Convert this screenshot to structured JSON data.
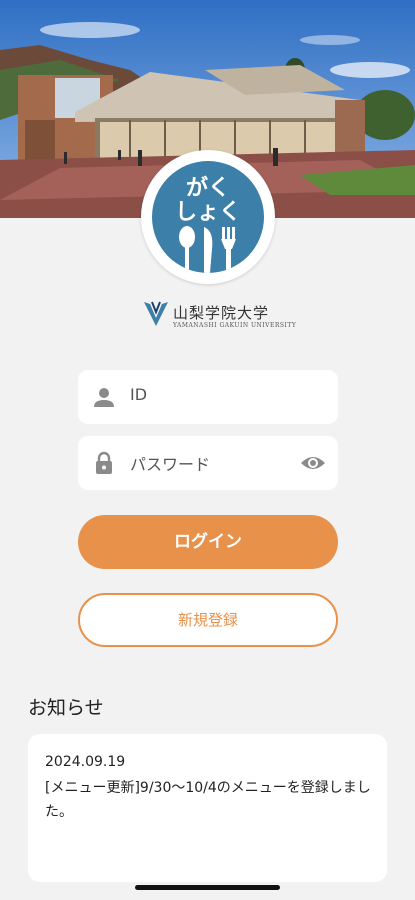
{
  "app": {
    "logo_line1": "がく",
    "logo_line2": "しょく",
    "university_name": "山梨学院大学",
    "university_sub": "YAMANASHI GAKUIN UNIVERSITY"
  },
  "form": {
    "id_placeholder": "ID",
    "password_placeholder": "パスワード",
    "login_label": "ログイン",
    "register_label": "新規登録"
  },
  "news": {
    "title": "お知らせ",
    "items": [
      {
        "date": "2024.09.19",
        "text": "[メニュー更新]9/30〜10/4のメニューを登録しました。"
      }
    ]
  },
  "colors": {
    "accent": "#e8914a",
    "logo_blue": "#3c7fa8",
    "background": "#f2f2f2"
  },
  "icons": [
    "person-icon",
    "lock-icon",
    "eye-icon",
    "fork-knife-spoon-icon",
    "university-emblem-icon"
  ]
}
